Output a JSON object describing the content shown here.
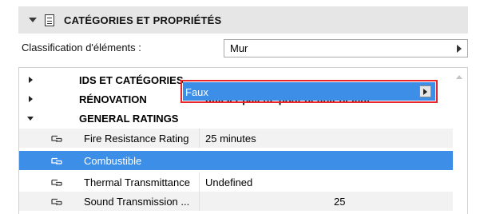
{
  "panel": {
    "title": "CATÉGORIES ET PROPRIÉTÉS"
  },
  "classification": {
    "label": "Classification d'éléments :",
    "value": "Mur"
  },
  "categories": [
    {
      "name": "IDS ET CATÉGORIES",
      "value": "",
      "expanded": false
    },
    {
      "name": "RÉNOVATION",
      "value": "utiliser palette pour définir défaut",
      "expanded": false
    },
    {
      "name": "GENERAL RATINGS",
      "value": "",
      "expanded": true
    }
  ],
  "properties": [
    {
      "name": "Fire Resistance Rating",
      "value": "25 minutes"
    },
    {
      "name": "Combustible",
      "value": "Faux",
      "selected": true
    },
    {
      "name": "Thermal Transmittance",
      "value": "Undefined"
    },
    {
      "name": "Sound Transmission ...",
      "value": "25"
    }
  ],
  "colors": {
    "selection": "#3d8ee6",
    "highlight_border": "#e8262b"
  },
  "icons": {
    "header_collapse": "chevron-down-icon",
    "header_panel": "properties-panel-icon",
    "property_link": "link-icon"
  }
}
